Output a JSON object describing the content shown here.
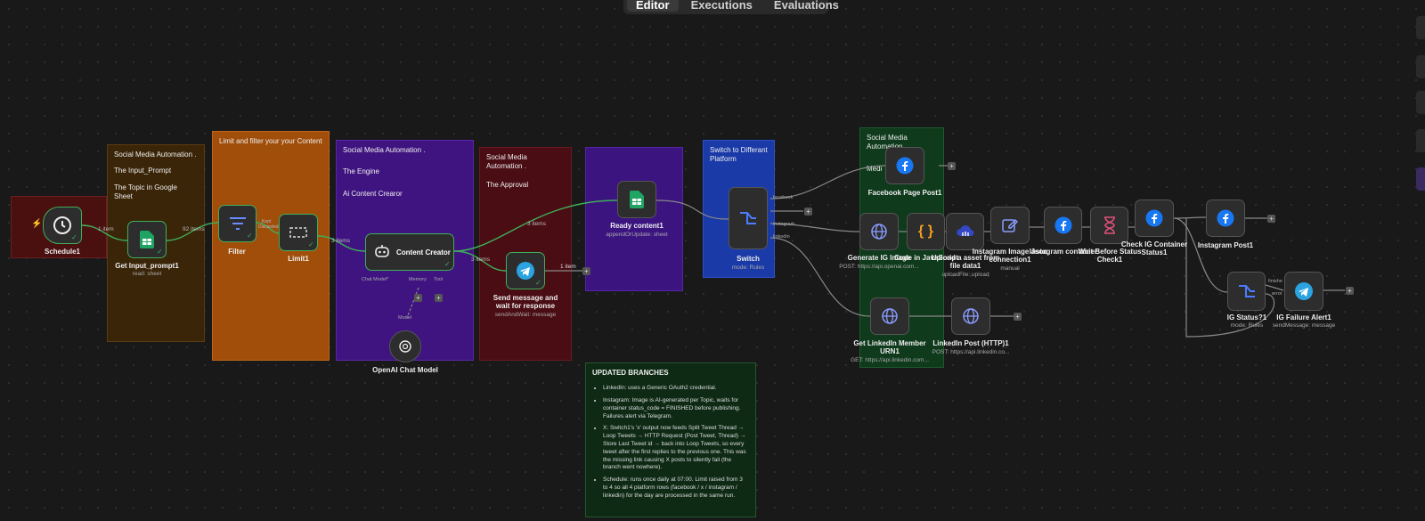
{
  "tabs": {
    "editor": "Editor",
    "executions": "Executions",
    "evaluations": "Evaluations"
  },
  "stickies": {
    "input": {
      "title": "Social Media Automation .",
      "line2": "The Input_Prompt",
      "line3": "The Topic in Google Sheet"
    },
    "limit": {
      "title": "Limit and filter your your Content"
    },
    "engine": {
      "title": "Social Media Automation .",
      "line2": "The Engine",
      "line3": "Ai Content Crearor"
    },
    "approval": {
      "title": "Social Media Automation .",
      "line2": "The Approval"
    },
    "switch": {
      "title": "Switch to Differant Platform"
    },
    "social": {
      "title": "Social Media Automation",
      "line2": "Medi"
    },
    "updates": {
      "title": "UPDATED BRANCHES",
      "items": [
        "LinkedIn: uses a Generic OAuth2 credential.",
        "Instagram: Image is AI-generated per Topic, waits for container status_code = FINISHED before publishing. Failures alert via Telegram.",
        "X: Switch1's 'x' output now feeds Split Tweet Thread → Loop Tweets → HTTP Request (Post Tweet, Thread) → Store Last Tweet id → back into Loop Tweets, so every tweet after the first replies to the previous one. This was the missing link causing X posts to silently fail (the branch went nowhere).",
        "Schedule: runs once daily at 07:00. Limit raised from 3 to 4 so all 4 platform rows (facebook / x / instagram / linkedin) for the day are processed in the same run."
      ]
    }
  },
  "nodes": {
    "schedule": {
      "label": "Schedule1"
    },
    "getinput": {
      "label": "Get Input_prompt1",
      "sub": "read: sheet"
    },
    "filter": {
      "label": "Filter"
    },
    "limit": {
      "label": "Limit1"
    },
    "creator": {
      "label": "Content Creator",
      "port_chat": "Chat Model*",
      "port_memory": "Memory",
      "port_tool": "Tool"
    },
    "openai": {
      "label": "OpenAI Chat Model",
      "port_model": "Model"
    },
    "telegram": {
      "label": "Send message and wait for response",
      "sub": "sendAndWait: message"
    },
    "ready": {
      "label": "Ready content1",
      "sub": "appendOrUpdate: sheet"
    },
    "switch": {
      "label": "Switch",
      "sub": "mode: Rules",
      "out1": "facebook",
      "out3": "instagram",
      "out4": "linkedin"
    },
    "fbpage": {
      "label": "Facebook Page Post1"
    },
    "genig": {
      "label": "Generate IG Image",
      "sub": "POST: https://api.openai.com..."
    },
    "code": {
      "label": "Code in JavaScript"
    },
    "upload": {
      "label": "Upload a asset from file data1",
      "sub": "uploadFile: upload"
    },
    "igimg": {
      "label": "Instagram Image Json connection1",
      "sub": "manual"
    },
    "igcontainer": {
      "label": "Instagram container"
    },
    "wait": {
      "label": "Wait Before Status Check1"
    },
    "checkig": {
      "label": "Check IG Container Status1"
    },
    "igpost": {
      "label": "Instagram Post1"
    },
    "igstatus": {
      "label": "IG Status?1",
      "sub": "mode: Rules",
      "out1": "finishe",
      "out2": "error"
    },
    "igfail": {
      "label": "IG Failure Alert1",
      "sub": "sendMessage: message"
    },
    "liurn": {
      "label": "Get LinkedIn Member URN1",
      "sub": "GET: https://api.linkedin.com..."
    },
    "lipost": {
      "label": "LinkedIn Post (HTTP)1",
      "sub": "POST: https://api.linkedin.co..."
    }
  },
  "edges": {
    "e1": "1 item",
    "e2": "92 items",
    "e3": "Kept",
    "e3b": "Discarded",
    "e4": "3 items",
    "e5": "3 items",
    "e6": "3 items",
    "e7": "1 item"
  },
  "colors": {
    "green_check": "#3fae5a",
    "sheets": "#1fa463",
    "telegram": "#2aa3e0",
    "facebook": "#1877f2",
    "switch": "#4c7dff"
  }
}
